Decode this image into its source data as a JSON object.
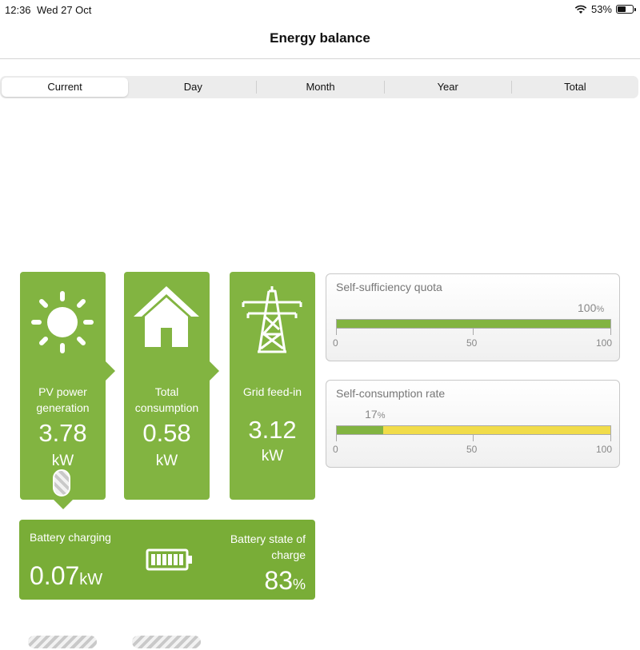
{
  "status_bar": {
    "time": "12:36",
    "date": "Wed 27 Oct",
    "battery_percent": "53%",
    "battery_level": 0.53
  },
  "title": "Energy balance",
  "tabs": [
    {
      "label": "Current",
      "active": true
    },
    {
      "label": "Day",
      "active": false
    },
    {
      "label": "Month",
      "active": false
    },
    {
      "label": "Year",
      "active": false
    },
    {
      "label": "Total",
      "active": false
    }
  ],
  "pv": {
    "label": "PV power generation",
    "value": "3.78",
    "unit": "kW",
    "icon": "sun-icon"
  },
  "consumption": {
    "label": "Total consumption",
    "value": "0.58",
    "unit": "kW",
    "icon": "house-icon"
  },
  "grid": {
    "label": "Grid feed-in",
    "value": "3.12",
    "unit": "kW",
    "icon": "power-pylon-icon"
  },
  "battery": {
    "charging_label": "Battery charging",
    "charging_value": "0.07",
    "charging_unit": "kW",
    "soc_label_line1": "Battery state of",
    "soc_label_line2": "charge",
    "soc_value": "83",
    "soc_unit": "%",
    "icon": "battery-icon"
  },
  "self_sufficiency": {
    "label": "Self-sufficiency quota",
    "value": "100",
    "unit": "%",
    "fraction": 1.0,
    "ticks": [
      "0",
      "50",
      "100"
    ]
  },
  "self_consumption": {
    "label": "Self-consumption rate",
    "value": "17",
    "unit": "%",
    "fraction": 0.17,
    "ticks": [
      "0",
      "50",
      "100"
    ]
  },
  "colors": {
    "tile_green": "#82b441",
    "battery_green": "#79ad37",
    "bar_green": "#82b441",
    "bar_yellow": "#f1dc4a"
  }
}
